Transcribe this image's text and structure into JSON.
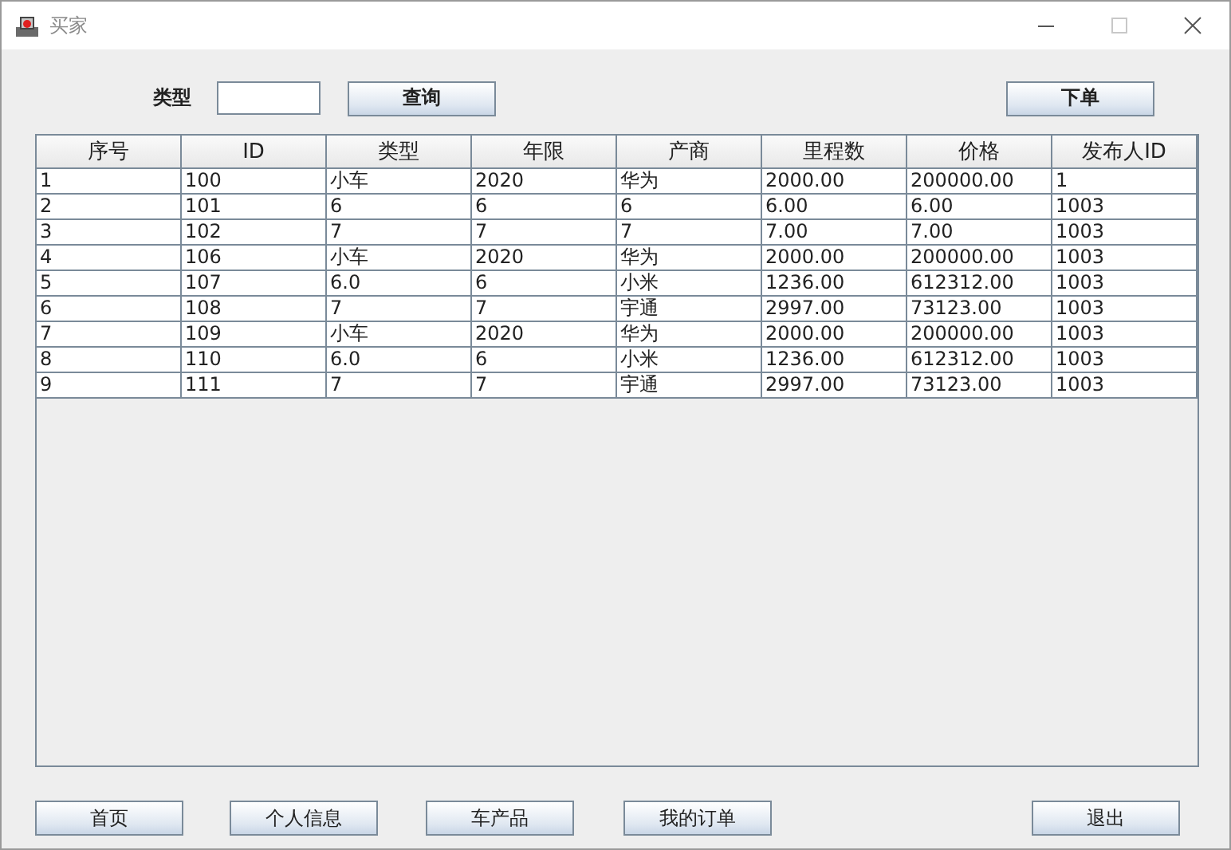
{
  "window": {
    "title": "买家"
  },
  "search": {
    "label": "类型",
    "button": "查询"
  },
  "order_button": "下单",
  "table": {
    "columns": [
      "序号",
      "ID",
      "类型",
      "年限",
      "产商",
      "里程数",
      "价格",
      "发布人ID"
    ],
    "rows": [
      [
        "1",
        "100",
        "小车",
        "2020",
        "华为",
        "2000.00",
        "200000.00",
        "1"
      ],
      [
        "2",
        "101",
        "6",
        "6",
        "6",
        "6.00",
        "6.00",
        "1003"
      ],
      [
        "3",
        "102",
        "7",
        "7",
        "7",
        "7.00",
        "7.00",
        "1003"
      ],
      [
        "4",
        "106",
        "小车",
        "2020",
        "华为",
        "2000.00",
        "200000.00",
        "1003"
      ],
      [
        "5",
        "107",
        "6.0",
        "6",
        "小米",
        "1236.00",
        "612312.00",
        "1003"
      ],
      [
        "6",
        "108",
        "7",
        "7",
        "宇通",
        "2997.00",
        "73123.00",
        "1003"
      ],
      [
        "7",
        "109",
        "小车",
        "2020",
        "华为",
        "2000.00",
        "200000.00",
        "1003"
      ],
      [
        "8",
        "110",
        "6.0",
        "6",
        "小米",
        "1236.00",
        "612312.00",
        "1003"
      ],
      [
        "9",
        "111",
        "7",
        "7",
        "宇通",
        "2997.00",
        "73123.00",
        "1003"
      ]
    ]
  },
  "nav_buttons": [
    "首页",
    "个人信息",
    "车产品",
    "我的订单"
  ],
  "exit_button": "退出"
}
